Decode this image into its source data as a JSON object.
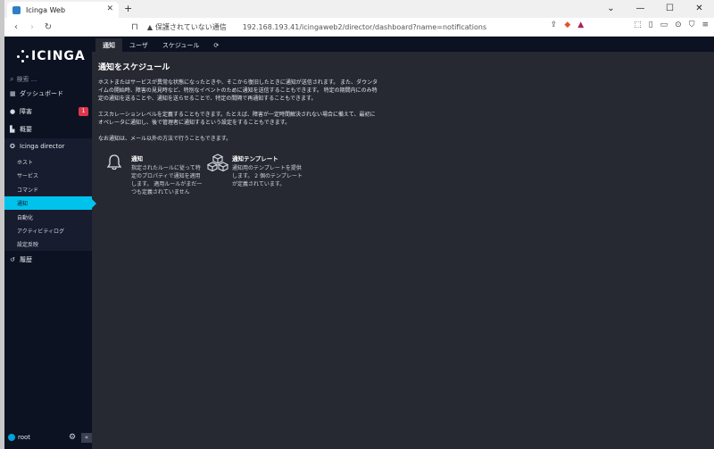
{
  "browser": {
    "tab_title": "Icinga Web",
    "new_tab": "+",
    "security_warning": "保護されていない通信",
    "url": "192.168.193.41/icingaweb2/director/dashboard?name=notifications"
  },
  "sidebar": {
    "logo": "ICINGA",
    "search_placeholder": "検索 ...",
    "items": [
      {
        "label": "ダッシュボード",
        "icon": "dashboard-icon"
      },
      {
        "label": "障害",
        "icon": "problems-icon",
        "badge": "1"
      },
      {
        "label": "概要",
        "icon": "overview-icon"
      },
      {
        "label": "Icinga director",
        "icon": "director-icon"
      }
    ],
    "director_sub": [
      {
        "label": "ホスト"
      },
      {
        "label": "サービス"
      },
      {
        "label": "コマンド"
      },
      {
        "label": "通知",
        "active": true
      },
      {
        "label": "自動化"
      },
      {
        "label": "アクティビティログ"
      },
      {
        "label": "設定反映"
      }
    ],
    "history": "履歴",
    "user": "root"
  },
  "main": {
    "tabs": [
      "通知",
      "ユーザ",
      "スケジュール"
    ],
    "title": "通知をスケジュール",
    "paragraphs": [
      "ホストまたはサービスが異常な状態になったときや、そこから復旧したときに通知が送信されます。 また、ダウンタイムの開始時、障害の見見時など、特別なイベントのために通知を送信することもできます。 特定の期間内にのみ特定の通知を送ることや、通知を送らせることで、特定の間隔で再通知することもできます。",
      "エスカレーションレベルを定義することもできます。たとえば、障害が一定時間解決されない場合に備えて、最初にオペレータに通知し、後で管理者に通知するという設定をすることもできます。",
      "なお通知は、メール以外の方法で行うこともできます。"
    ],
    "cards": [
      {
        "title": "通知",
        "desc": "指定されたルールに従って特定のプロパティで通知を適用します。 適用ルールがまだ一つも定義されていません",
        "icon": "bell-icon"
      },
      {
        "title": "通知テンプレート",
        "desc": "通知用のテンプレートを提供します。 2 個のテンプレートが定義されています。",
        "icon": "cubes-icon"
      }
    ]
  }
}
